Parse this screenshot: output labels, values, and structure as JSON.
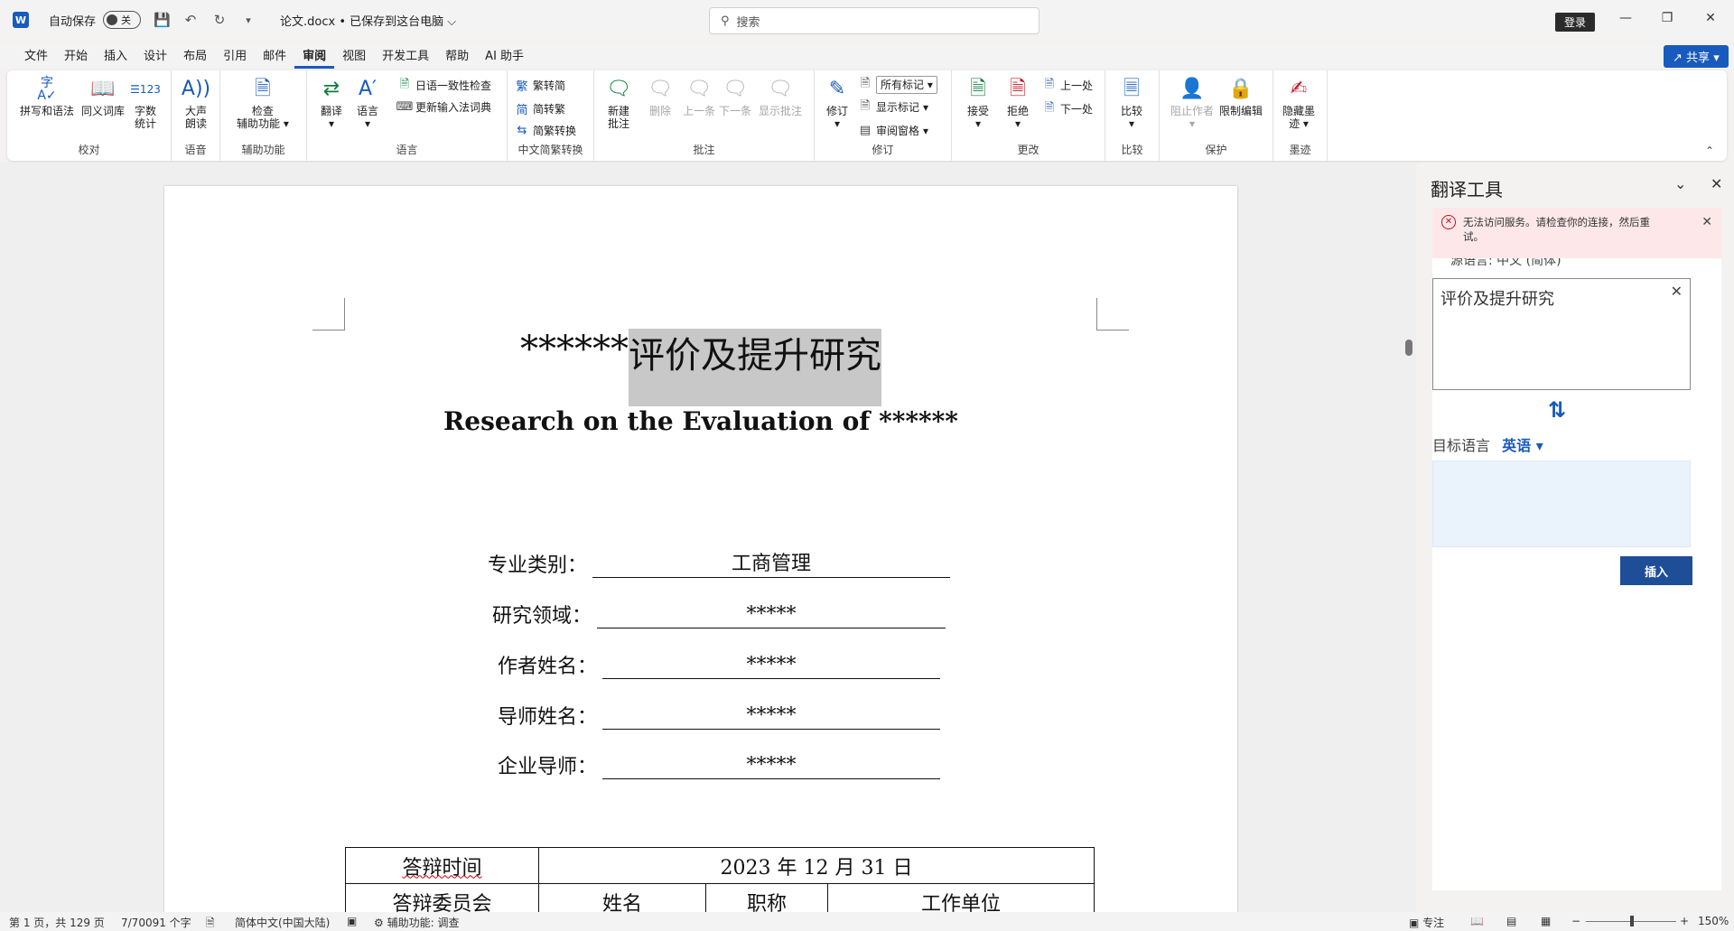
{
  "titlebar": {
    "app_letter": "W",
    "autosave_label": "自动保存",
    "autosave_state": "关",
    "doc_title": "论文.docx • 已保存到这台电脑 ⌵",
    "search_placeholder": "搜索",
    "login_label": "登录"
  },
  "menu": {
    "tabs": [
      "文件",
      "开始",
      "插入",
      "设计",
      "布局",
      "引用",
      "邮件",
      "审阅",
      "视图",
      "开发工具",
      "帮助",
      "AI 助手"
    ],
    "active": "审阅",
    "share_label": "共享"
  },
  "ribbon": {
    "groups": {
      "proofing": {
        "label": "校对",
        "spell": "拼写和语法",
        "thesaurus": "同义词库",
        "wordcount_1": "字数",
        "wordcount_2": "统计"
      },
      "speech": {
        "label": "语音",
        "read_1": "大声",
        "read_2": "朗读"
      },
      "accessibility": {
        "label": "辅助功能",
        "check_1": "检查",
        "check_2": "辅助功能"
      },
      "language": {
        "label": "语言",
        "translate": "翻译",
        "language": "语言",
        "jp_check": "日语一致性检查",
        "ime_update": "更新输入法词典"
      },
      "chinese": {
        "label": "中文简繁转换",
        "to_simp": "繁转简",
        "to_trad": "简转繁",
        "convert": "简繁转换"
      },
      "comments": {
        "label": "批注",
        "new_1": "新建",
        "new_2": "批注",
        "delete": "删除",
        "prev": "上一条",
        "next": "下一条",
        "show": "显示批注"
      },
      "tracking": {
        "label": "修订",
        "track": "修订",
        "markup_select": "所有标记",
        "show_markup": "显示标记",
        "review_pane": "审阅窗格"
      },
      "changes": {
        "label": "更改",
        "accept": "接受",
        "reject": "拒绝",
        "prev": "上一处",
        "next": "下一处"
      },
      "compare": {
        "label": "比较",
        "compare": "比较"
      },
      "protect": {
        "label": "保护",
        "block": "阻止作者",
        "restrict": "限制编辑"
      },
      "ink": {
        "label": "墨迹",
        "hide_1": "隐藏墨",
        "hide_2": "迹"
      }
    }
  },
  "document": {
    "title_prefix": "******",
    "title_highlight": "评价及提升研究",
    "title_en": "Research on the Evaluation of ******",
    "fields": [
      {
        "label": "专业类别：",
        "value": "工商管理"
      },
      {
        "label": "研究领域：",
        "value": "*****"
      },
      {
        "label": "作者姓名：",
        "value": "*****"
      },
      {
        "label": "导师姓名：",
        "value": "*****"
      },
      {
        "label": "企业导师：",
        "value": "*****"
      }
    ],
    "table": {
      "row1": [
        "答辩时间",
        "2023 年 12 月 31 日"
      ],
      "row2": [
        "答辩委员会",
        "姓名",
        "职称",
        "工作单位"
      ]
    }
  },
  "translator": {
    "title": "翻译工具",
    "error_text": "无法访问服务。请检查你的连接，然后重试。",
    "source_label": "源语言: 中文 (简体)",
    "source_text": "评价及提升研究",
    "target_label": "目标语言",
    "target_lang": "英语",
    "insert_label": "插入"
  },
  "status": {
    "page": "第 1 页，共 129 页",
    "words": "7/70091 个字",
    "lang": "简体中文(中国大陆)",
    "accessibility": "辅助功能: 调查",
    "focus": "专注",
    "zoom": "150%"
  }
}
